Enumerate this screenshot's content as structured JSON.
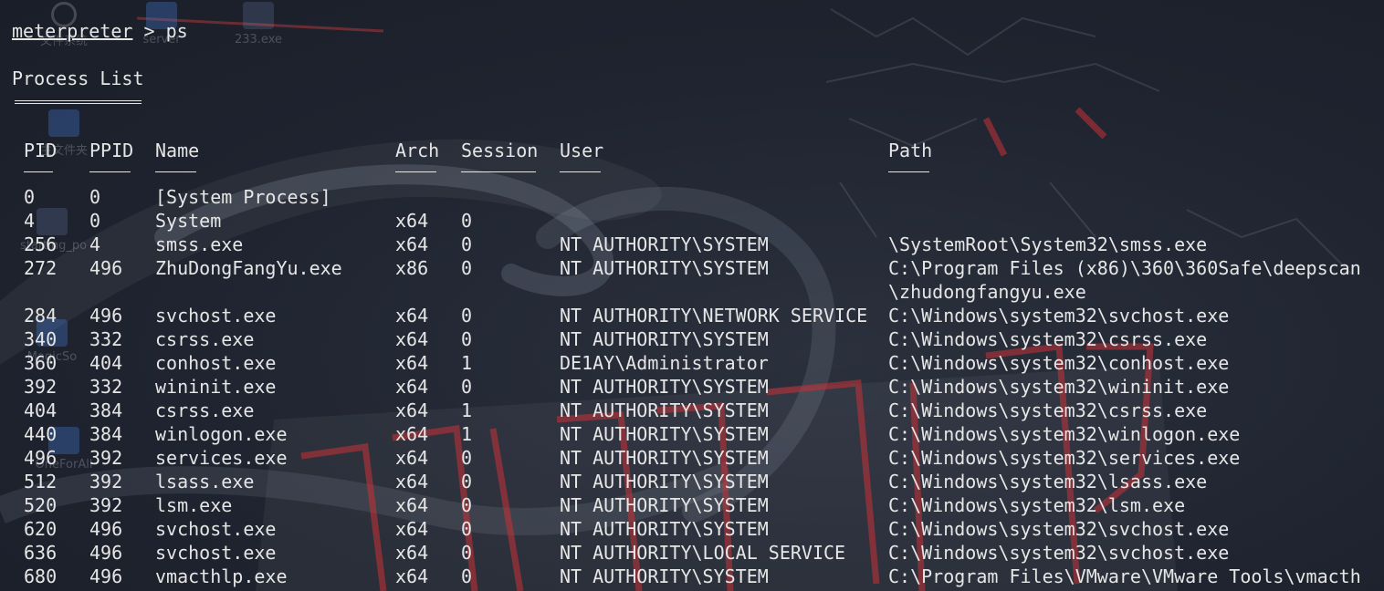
{
  "desktop": {
    "icons": [
      "文件系统",
      "server",
      "233.exe",
      "主文件夹",
      "starting_po",
      "MagicSo",
      "OneForAll"
    ]
  },
  "terminal": {
    "prompt": "meterpreter",
    "prompt_sep": " > ",
    "command": "ps",
    "title": "Process List",
    "headers": {
      "pid": "PID",
      "ppid": "PPID",
      "name": "Name",
      "arch": "Arch",
      "session": "Session",
      "user": "User",
      "path": "Path"
    },
    "rows": [
      {
        "pid": "0",
        "ppid": "0",
        "name": "[System Process]",
        "arch": "",
        "session": "",
        "user": "",
        "path": ""
      },
      {
        "pid": "4",
        "ppid": "0",
        "name": "System",
        "arch": "x64",
        "session": "0",
        "user": "",
        "path": ""
      },
      {
        "pid": "256",
        "ppid": "4",
        "name": "smss.exe",
        "arch": "x64",
        "session": "0",
        "user": "NT AUTHORITY\\SYSTEM",
        "path": "\\SystemRoot\\System32\\smss.exe"
      },
      {
        "pid": "272",
        "ppid": "496",
        "name": "ZhuDongFangYu.exe",
        "arch": "x86",
        "session": "0",
        "user": "NT AUTHORITY\\SYSTEM",
        "path": "C:\\Program Files (x86)\\360\\360Safe\\deepscan",
        "path_cont": "\\zhudongfangyu.exe"
      },
      {
        "pid": "284",
        "ppid": "496",
        "name": "svchost.exe",
        "arch": "x64",
        "session": "0",
        "user": "NT AUTHORITY\\NETWORK SERVICE",
        "path": "C:\\Windows\\system32\\svchost.exe"
      },
      {
        "pid": "340",
        "ppid": "332",
        "name": "csrss.exe",
        "arch": "x64",
        "session": "0",
        "user": "NT AUTHORITY\\SYSTEM",
        "path": "C:\\Windows\\system32\\csrss.exe"
      },
      {
        "pid": "360",
        "ppid": "404",
        "name": "conhost.exe",
        "arch": "x64",
        "session": "1",
        "user": "DE1AY\\Administrator",
        "path": "C:\\Windows\\system32\\conhost.exe"
      },
      {
        "pid": "392",
        "ppid": "332",
        "name": "wininit.exe",
        "arch": "x64",
        "session": "0",
        "user": "NT AUTHORITY\\SYSTEM",
        "path": "C:\\Windows\\system32\\wininit.exe"
      },
      {
        "pid": "404",
        "ppid": "384",
        "name": "csrss.exe",
        "arch": "x64",
        "session": "1",
        "user": "NT AUTHORITY\\SYSTEM",
        "path": "C:\\Windows\\system32\\csrss.exe"
      },
      {
        "pid": "440",
        "ppid": "384",
        "name": "winlogon.exe",
        "arch": "x64",
        "session": "1",
        "user": "NT AUTHORITY\\SYSTEM",
        "path": "C:\\Windows\\system32\\winlogon.exe"
      },
      {
        "pid": "496",
        "ppid": "392",
        "name": "services.exe",
        "arch": "x64",
        "session": "0",
        "user": "NT AUTHORITY\\SYSTEM",
        "path": "C:\\Windows\\system32\\services.exe"
      },
      {
        "pid": "512",
        "ppid": "392",
        "name": "lsass.exe",
        "arch": "x64",
        "session": "0",
        "user": "NT AUTHORITY\\SYSTEM",
        "path": "C:\\Windows\\system32\\lsass.exe"
      },
      {
        "pid": "520",
        "ppid": "392",
        "name": "lsm.exe",
        "arch": "x64",
        "session": "0",
        "user": "NT AUTHORITY\\SYSTEM",
        "path": "C:\\Windows\\system32\\lsm.exe"
      },
      {
        "pid": "620",
        "ppid": "496",
        "name": "svchost.exe",
        "arch": "x64",
        "session": "0",
        "user": "NT AUTHORITY\\SYSTEM",
        "path": "C:\\Windows\\system32\\svchost.exe"
      },
      {
        "pid": "636",
        "ppid": "496",
        "name": "svchost.exe",
        "arch": "x64",
        "session": "0",
        "user": "NT AUTHORITY\\LOCAL SERVICE",
        "path": "C:\\Windows\\system32\\svchost.exe"
      },
      {
        "pid": "680",
        "ppid": "496",
        "name": "vmacthlp.exe",
        "arch": "x64",
        "session": "0",
        "user": "NT AUTHORITY\\SYSTEM",
        "path": "C:\\Program Files\\VMware\\VMware Tools\\vmacth"
      }
    ]
  },
  "colors": {
    "text": "#e6e6e6",
    "background": "#1e2330",
    "accent_red": "#b8363a"
  }
}
